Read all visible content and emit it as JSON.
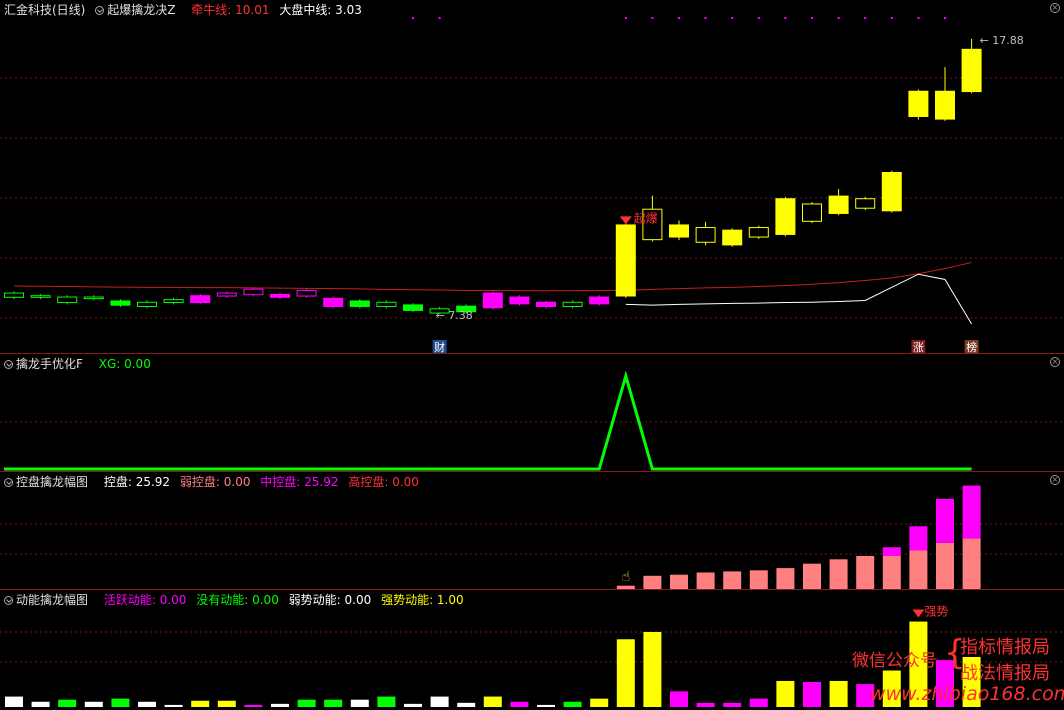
{
  "panel1": {
    "title": "汇金科技(日线)",
    "indicator": "起爆擒龙决Z",
    "line1_label": "牵牛线: 10.01",
    "line2_label": "大盘中线: 3.03",
    "high_label": "17.88",
    "low_label": "7.38",
    "tag_cai": "财",
    "tag_zhang": "涨",
    "tag_bang": "榜",
    "signal_text": "起爆"
  },
  "panel2": {
    "indicator": "擒龙手优化F",
    "xg_label": "XG: 0.00"
  },
  "panel3": {
    "indicator": "控盘擒龙幅图",
    "kp_label": "控盘: 25.92",
    "weak_label": "弱控盘: 0.00",
    "mid_label": "中控盘: 25.92",
    "high_label": "高控盘: 0.00"
  },
  "panel4": {
    "indicator": "动能擒龙幅图",
    "active_label": "活跃动能: 0.00",
    "none_label": "没有动能: 0.00",
    "weak_label": "弱势动能: 0.00",
    "strong_label": "强势动能: 1.00",
    "signal_text": "强势"
  },
  "watermark": {
    "wx": "微信公众号",
    "line1": "指标情报局",
    "line2": "战法情报局",
    "url": "www.zhibiao168.com"
  },
  "colors": {
    "red": "#ff3232",
    "yellow": "#ffff00",
    "magenta": "#ff00ff",
    "green": "#00ff00",
    "salmon": "#ff8080",
    "white": "#ffffff"
  },
  "chart_data": [
    {
      "type": "candlestick",
      "name": "main",
      "ylim": [
        6.2,
        18.6
      ],
      "candles": [
        {
          "o": 8.2,
          "c": 8.0,
          "h": 8.25,
          "l": 7.95,
          "col": "green",
          "fill": false
        },
        {
          "o": 8.1,
          "c": 8.0,
          "h": 8.15,
          "l": 7.95,
          "col": "green",
          "fill": false
        },
        {
          "o": 8.05,
          "c": 7.8,
          "h": 8.1,
          "l": 7.75,
          "col": "green",
          "fill": false
        },
        {
          "o": 8.05,
          "c": 7.95,
          "h": 8.1,
          "l": 7.9,
          "col": "green",
          "fill": false
        },
        {
          "o": 7.9,
          "c": 7.7,
          "h": 7.95,
          "l": 7.65,
          "col": "green",
          "fill": true
        },
        {
          "o": 7.85,
          "c": 7.65,
          "h": 7.9,
          "l": 7.6,
          "col": "green",
          "fill": false
        },
        {
          "o": 7.95,
          "c": 7.8,
          "h": 8.0,
          "l": 7.75,
          "col": "green",
          "fill": false
        },
        {
          "o": 7.8,
          "c": 8.1,
          "h": 8.15,
          "l": 7.75,
          "col": "magenta",
          "fill": true
        },
        {
          "o": 8.05,
          "c": 8.2,
          "h": 8.25,
          "l": 8.0,
          "col": "magenta",
          "fill": false
        },
        {
          "o": 8.1,
          "c": 8.35,
          "h": 8.4,
          "l": 8.05,
          "col": "magenta",
          "fill": false
        },
        {
          "o": 8.0,
          "c": 8.15,
          "h": 8.2,
          "l": 7.95,
          "col": "magenta",
          "fill": true
        },
        {
          "o": 8.05,
          "c": 8.3,
          "h": 8.35,
          "l": 8.0,
          "col": "magenta",
          "fill": false
        },
        {
          "o": 7.65,
          "c": 8.0,
          "h": 8.05,
          "l": 7.6,
          "col": "magenta",
          "fill": true
        },
        {
          "o": 7.9,
          "c": 7.65,
          "h": 7.95,
          "l": 7.6,
          "col": "green",
          "fill": true
        },
        {
          "o": 7.85,
          "c": 7.65,
          "h": 7.9,
          "l": 7.6,
          "col": "green",
          "fill": false
        },
        {
          "o": 7.75,
          "c": 7.5,
          "h": 7.8,
          "l": 7.45,
          "col": "green",
          "fill": true
        },
        {
          "o": 7.6,
          "c": 7.4,
          "h": 7.65,
          "l": 7.38,
          "col": "green",
          "fill": false
        },
        {
          "o": 7.7,
          "c": 7.45,
          "h": 7.75,
          "l": 7.4,
          "col": "green",
          "fill": true
        },
        {
          "o": 7.6,
          "c": 8.2,
          "h": 8.25,
          "l": 7.55,
          "col": "magenta",
          "fill": true
        },
        {
          "o": 7.75,
          "c": 8.05,
          "h": 8.1,
          "l": 7.7,
          "col": "magenta",
          "fill": true
        },
        {
          "o": 7.65,
          "c": 7.85,
          "h": 7.9,
          "l": 7.6,
          "col": "magenta",
          "fill": true
        },
        {
          "o": 7.85,
          "c": 7.65,
          "h": 7.9,
          "l": 7.6,
          "col": "green",
          "fill": false
        },
        {
          "o": 7.75,
          "c": 8.05,
          "h": 8.1,
          "l": 7.7,
          "col": "magenta",
          "fill": true
        },
        {
          "o": 8.05,
          "c": 10.8,
          "h": 10.85,
          "l": 8.0,
          "col": "yellow",
          "fill": true
        },
        {
          "o": 10.2,
          "c": 11.4,
          "h": 11.9,
          "l": 10.15,
          "col": "yellow",
          "fill": false
        },
        {
          "o": 10.3,
          "c": 10.8,
          "h": 10.95,
          "l": 10.2,
          "col": "yellow",
          "fill": true
        },
        {
          "o": 10.1,
          "c": 10.7,
          "h": 10.9,
          "l": 10.0,
          "col": "yellow",
          "fill": false
        },
        {
          "o": 10.0,
          "c": 10.6,
          "h": 10.65,
          "l": 9.95,
          "col": "yellow",
          "fill": true
        },
        {
          "o": 10.3,
          "c": 10.7,
          "h": 10.75,
          "l": 10.25,
          "col": "yellow",
          "fill": false
        },
        {
          "o": 10.4,
          "c": 11.8,
          "h": 11.85,
          "l": 10.35,
          "col": "yellow",
          "fill": true
        },
        {
          "o": 10.9,
          "c": 11.6,
          "h": 11.65,
          "l": 10.85,
          "col": "yellow",
          "fill": false
        },
        {
          "o": 11.2,
          "c": 11.9,
          "h": 12.15,
          "l": 11.15,
          "col": "yellow",
          "fill": true
        },
        {
          "o": 11.4,
          "c": 11.8,
          "h": 11.85,
          "l": 11.35,
          "col": "yellow",
          "fill": false
        },
        {
          "o": 11.3,
          "c": 12.8,
          "h": 12.85,
          "l": 11.25,
          "col": "yellow",
          "fill": true
        },
        {
          "o": 14.9,
          "c": 15.9,
          "h": 15.95,
          "l": 14.8,
          "col": "yellow",
          "fill": true
        },
        {
          "o": 14.8,
          "c": 15.9,
          "h": 16.8,
          "l": 14.75,
          "col": "yellow",
          "fill": true
        },
        {
          "o": 15.85,
          "c": 17.5,
          "h": 17.88,
          "l": 15.8,
          "col": "yellow",
          "fill": true
        }
      ],
      "line_red": [
        8.45,
        8.44,
        8.43,
        8.42,
        8.41,
        8.4,
        8.4,
        8.39,
        8.39,
        8.38,
        8.37,
        8.36,
        8.35,
        8.34,
        8.32,
        8.31,
        8.3,
        8.28,
        8.28,
        8.27,
        8.27,
        8.27,
        8.28,
        8.29,
        8.32,
        8.35,
        8.38,
        8.4,
        8.43,
        8.47,
        8.52,
        8.58,
        8.66,
        8.76,
        8.92,
        9.12,
        9.35
      ],
      "line_white": [
        null,
        null,
        null,
        null,
        null,
        null,
        null,
        null,
        null,
        null,
        null,
        null,
        null,
        null,
        null,
        null,
        null,
        null,
        null,
        null,
        null,
        null,
        null,
        7.75,
        7.72,
        7.75,
        7.77,
        7.79,
        7.8,
        7.82,
        7.83,
        7.86,
        7.9,
        8.4,
        8.9,
        8.7,
        7.0
      ],
      "dot_candles": [
        15,
        16,
        23,
        24,
        25,
        26,
        27,
        28,
        29,
        30,
        31,
        32,
        33,
        34,
        35
      ]
    },
    {
      "type": "line",
      "name": "XG",
      "ylim": [
        0,
        1
      ],
      "values": [
        0,
        0,
        0,
        0,
        0,
        0,
        0,
        0,
        0,
        0,
        0,
        0,
        0,
        0,
        0,
        0,
        0,
        0,
        0,
        0,
        0,
        0,
        0,
        1,
        0,
        0,
        0,
        0,
        0,
        0,
        0,
        0,
        0,
        0,
        0,
        0,
        0
      ]
    },
    {
      "type": "bar",
      "name": "控盘",
      "ylim": [
        0,
        90
      ],
      "values": [
        0,
        0,
        0,
        0,
        0,
        0,
        0,
        0,
        0,
        0,
        0,
        0,
        0,
        0,
        0,
        0,
        0,
        0,
        0,
        0,
        0,
        0,
        0,
        3,
        12,
        13,
        15,
        16,
        17,
        19,
        23,
        27,
        30,
        30,
        35,
        42,
        46
      ],
      "mid": [
        0,
        0,
        0,
        0,
        0,
        0,
        0,
        0,
        0,
        0,
        0,
        0,
        0,
        0,
        0,
        0,
        0,
        0,
        0,
        0,
        0,
        0,
        0,
        0,
        0,
        0,
        0,
        0,
        0,
        0,
        0,
        0,
        0,
        8,
        22,
        40,
        48
      ]
    },
    {
      "type": "bar",
      "name": "动能",
      "ylim": [
        0,
        95
      ],
      "values": [
        10,
        5,
        7,
        5,
        8,
        5,
        2,
        6,
        6,
        2,
        3,
        7,
        7,
        7,
        10,
        3,
        10,
        4,
        10,
        5,
        2,
        5,
        8,
        65,
        72,
        15,
        4,
        4,
        8,
        25,
        24,
        25,
        22,
        35,
        82,
        45,
        48
      ],
      "cols": [
        "white",
        "white",
        "green",
        "white",
        "green",
        "white",
        "white",
        "yellow",
        "yellow",
        "magenta",
        "white",
        "green",
        "green",
        "white",
        "green",
        "white",
        "white",
        "white",
        "yellow",
        "magenta",
        "white",
        "green",
        "yellow",
        "yellow",
        "yellow",
        "magenta",
        "magenta",
        "magenta",
        "magenta",
        "yellow",
        "magenta",
        "yellow",
        "magenta",
        "yellow",
        "yellow",
        "magenta",
        "yellow"
      ]
    }
  ]
}
